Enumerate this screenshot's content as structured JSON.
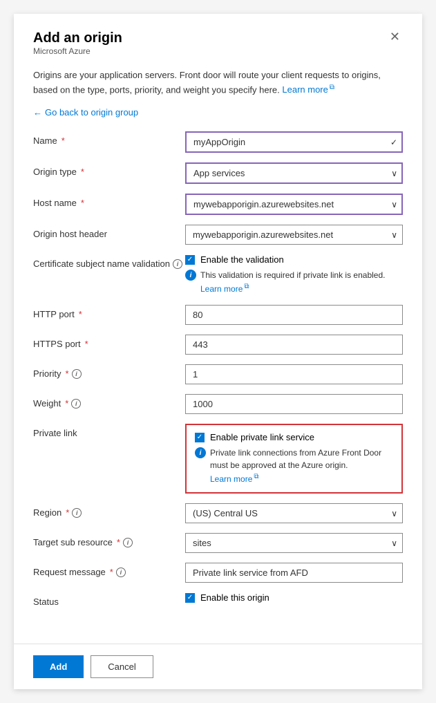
{
  "panel": {
    "title": "Add an origin",
    "subtitle": "Microsoft Azure"
  },
  "description": {
    "text": "Origins are your application servers. Front door will route your client requests to origins, based on the type, ports, priority, and weight you specify here.",
    "learn_more": "Learn more"
  },
  "back_link": "Go back to origin group",
  "form": {
    "name": {
      "label": "Name",
      "required": true,
      "value": "myAppOrigin"
    },
    "origin_type": {
      "label": "Origin type",
      "required": true,
      "value": "App services"
    },
    "host_name": {
      "label": "Host name",
      "required": true,
      "value": "mywebapporigin.azurewebsites.net"
    },
    "origin_host_header": {
      "label": "Origin host header",
      "required": false,
      "value": "mywebapporigin.azurewebsites.net"
    },
    "certificate_validation": {
      "label": "Certificate subject name validation",
      "has_info": true,
      "checkbox_label": "Enable the validation",
      "checked": true,
      "info_text": "This validation is required if private link is enabled.",
      "info_learn_more": "Learn more"
    },
    "http_port": {
      "label": "HTTP port",
      "required": true,
      "value": "80"
    },
    "https_port": {
      "label": "HTTPS port",
      "required": true,
      "value": "443"
    },
    "priority": {
      "label": "Priority",
      "required": true,
      "has_info": true,
      "value": "1"
    },
    "weight": {
      "label": "Weight",
      "required": true,
      "has_info": true,
      "value": "1000"
    },
    "private_link": {
      "label": "Private link",
      "checkbox_label": "Enable private link service",
      "checked": true,
      "info_text": "Private link connections from Azure Front Door must be approved at the Azure origin.",
      "info_learn_more": "Learn more"
    },
    "region": {
      "label": "Region",
      "required": true,
      "has_info": true,
      "value": "(US) Central US"
    },
    "target_sub_resource": {
      "label": "Target sub resource",
      "required": true,
      "has_info": true,
      "value": "sites"
    },
    "request_message": {
      "label": "Request message",
      "required": true,
      "has_info": true,
      "value": "Private link service from AFD"
    },
    "status": {
      "label": "Status",
      "checkbox_label": "Enable this origin",
      "checked": true
    }
  },
  "footer": {
    "add_label": "Add",
    "cancel_label": "Cancel"
  }
}
